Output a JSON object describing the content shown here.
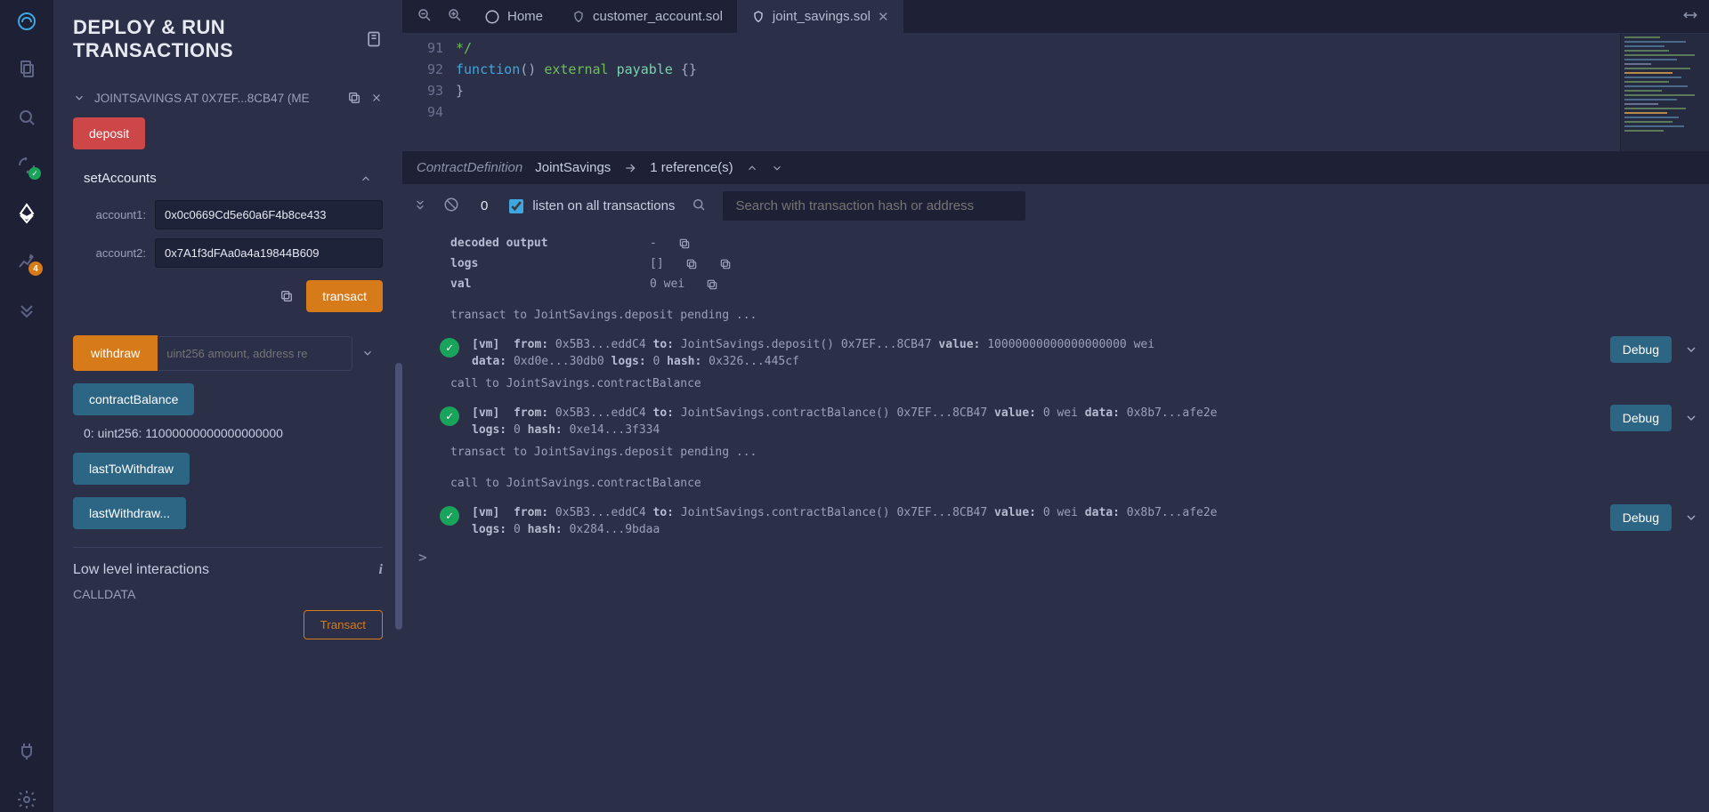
{
  "panel": {
    "title": "DEPLOY & RUN TRANSACTIONS",
    "contract_line": "JOINTSAVINGS AT 0X7EF...8CB47 (ME",
    "deposit_label": "deposit",
    "set_accounts_title": "setAccounts",
    "account1_label": "account1:",
    "account1_value": "0x0c0669Cd5e60a6F4b8ce433",
    "account2_label": "account2:",
    "account2_value": "0x7A1f3dFAa0a4a19844B609",
    "transact_label": "transact",
    "withdraw_label": "withdraw",
    "withdraw_placeholder": "uint256 amount, address re",
    "contract_balance_label": "contractBalance",
    "balance_result": "0: uint256: 11000000000000000000",
    "last_to_withdraw_label": "lastToWithdraw",
    "last_withdraw_label": "lastWithdraw...",
    "low_level_title": "Low level interactions",
    "calldata_label": "CALLDATA",
    "low_transact_label": "Transact"
  },
  "nav_badge_count": "4",
  "tabs": {
    "home": "Home",
    "t1": "customer_account.sol",
    "t2": "joint_savings.sol"
  },
  "editor": {
    "lines": [
      "91",
      "92",
      "93",
      "94"
    ],
    "l91_tail": "*/",
    "l92_indent": "        ",
    "l92_fn": "function",
    "l92_paren": "() ",
    "l92_ext": "external",
    "l92_pay": " payable",
    "l92_body": " {}",
    "l93": "    }"
  },
  "breadcrumb": {
    "prefix": "ContractDefinition",
    "name": "JointSavings",
    "refs": "1 reference(s)"
  },
  "terminal": {
    "pending_count": "0",
    "listen_label": "listen on all transactions",
    "search_placeholder": "Search with transaction hash or address",
    "decoded_output_k": "decoded output",
    "decoded_output_v": "-",
    "logs_k": "logs",
    "logs_v": "[]",
    "val_k": "val",
    "val_v": "0 wei",
    "pending1": "transact to JointSavings.deposit pending ...",
    "tx1_vm": "[vm]",
    "tx1_from_k": "from:",
    "tx1_from_v": " 0x5B3...eddC4 ",
    "tx1_to_k": "to:",
    "tx1_to_v": " JointSavings.deposit() 0x7EF...8CB47 ",
    "tx1_value_k": "value:",
    "tx1_value_v": " 10000000000000000000 wei ",
    "tx1_data_k": "data:",
    "tx1_data_v": " 0xd0e...30db0 ",
    "tx1_logs_k": "logs:",
    "tx1_logs_v": " 0 ",
    "tx1_hash_k": "hash:",
    "tx1_hash_v": " 0x326...445cf",
    "call1": "call to JointSavings.contractBalance",
    "tx2_vm": "[vm]",
    "tx2_from_k": "from:",
    "tx2_from_v": " 0x5B3...eddC4 ",
    "tx2_to_k": "to:",
    "tx2_to_v": " JointSavings.contractBalance() 0x7EF...8CB47 ",
    "tx2_value_k": "value:",
    "tx2_value_v": " 0 wei ",
    "tx2_data_k": "data:",
    "tx2_data_v": " 0x8b7...afe2e ",
    "tx2_logs_k": "logs:",
    "tx2_logs_v": " 0 ",
    "tx2_hash_k": "hash:",
    "tx2_hash_v": " 0xe14...3f334",
    "pending2": "transact to JointSavings.deposit pending ...",
    "call2": "call to JointSavings.contractBalance",
    "tx3_vm": "[vm]",
    "tx3_from_k": "from:",
    "tx3_from_v": " 0x5B3...eddC4 ",
    "tx3_to_k": "to:",
    "tx3_to_v": " JointSavings.contractBalance() 0x7EF...8CB47 ",
    "tx3_value_k": "value:",
    "tx3_value_v": " 0 wei ",
    "tx3_data_k": "data:",
    "tx3_data_v": " 0x8b7...afe2e ",
    "tx3_logs_k": "logs:",
    "tx3_logs_v": " 0 ",
    "tx3_hash_k": "hash:",
    "tx3_hash_v": " 0x284...9bdaa",
    "debug_label": "Debug",
    "prompt": ">"
  }
}
